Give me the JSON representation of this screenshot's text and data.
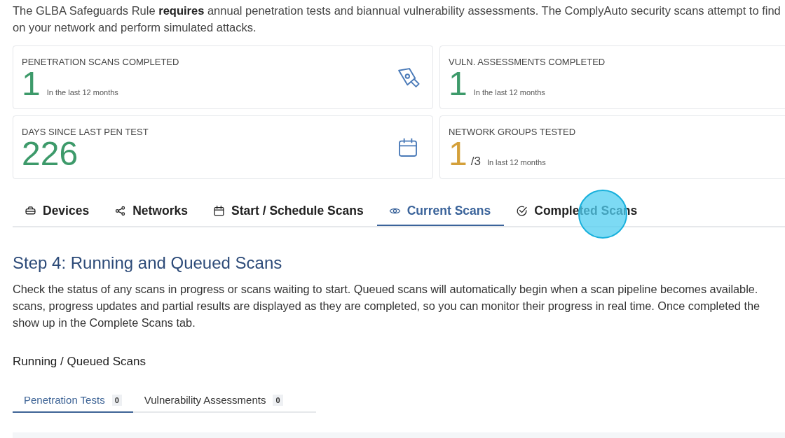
{
  "intro": {
    "lines": [
      "The GLBA Safeguards Rule **requires** annual penetration tests and biannual vulnerability assessments. The ComplyAuto security scans attempt to find",
      "on your network and perform simulated attacks."
    ]
  },
  "stats": [
    {
      "label": "PENETRATION SCANS COMPLETED",
      "value": "1",
      "note": "In the last 12 months",
      "color": "#3d9a6a"
    },
    {
      "label": "VULN. ASSESSMENTS COMPLETED",
      "value": "1",
      "note": "In the last 12 months",
      "color": "#3d9a6a"
    },
    {
      "label": "DAYS SINCE LAST PEN TEST",
      "value": "226",
      "color": "#3d9a6a"
    },
    {
      "label": "NETWORK GROUPS TESTED",
      "value": "1",
      "total": "/3",
      "note": "In last 12 months",
      "color": "#d4a03a"
    }
  ],
  "tabs": [
    {
      "label": "Devices",
      "selected": false
    },
    {
      "label": "Networks",
      "selected": false
    },
    {
      "label": "Start / Schedule Scans",
      "selected": false
    },
    {
      "label": "Current Scans",
      "selected": true
    },
    {
      "label": "Completed Scans",
      "selected": false
    }
  ],
  "step": {
    "title": "Step 4: Running and Queued Scans",
    "lines": [
      "Check the status of any scans in progress or scans waiting to start. Queued scans will automatically begin when a scan pipeline becomes available.",
      "scans, progress updates and partial results are displayed as they are completed, so you can monitor their progress in real time. Once completed the",
      "show up in the Complete Scans tab."
    ]
  },
  "section_title": "Running / Queued Scans",
  "subtabs": [
    {
      "label": "Penetration Tests",
      "count": "0",
      "selected": true
    },
    {
      "label": "Vulnerability Assessments",
      "count": "0",
      "selected": false
    }
  ]
}
